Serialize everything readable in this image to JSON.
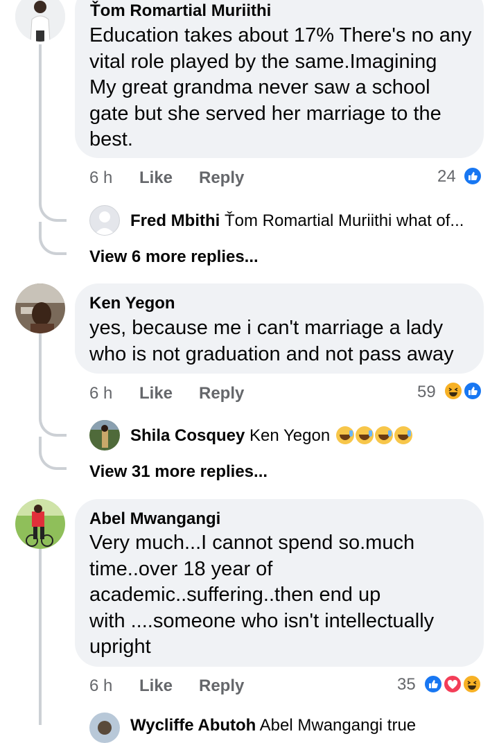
{
  "comments": [
    {
      "author": "Ťom Romartial Muriithi",
      "text": "Education takes about 17% There's no any\nvital role played by the same.Imagining\nMy great  grandma never saw a school\ngate but she served her marriage to the\nbest.",
      "time": "6 h",
      "like_label": "Like",
      "reply_label": "Reply",
      "reaction_count": "24",
      "reactions": [
        "like"
      ],
      "reply_preview": {
        "author": "Fred Mbithi",
        "text": "Ťom Romartial Muriithi what of..."
      },
      "view_more": "View 6 more replies..."
    },
    {
      "author": "Ken Yegon",
      "text": "yes, because me i can't marriage a lady\nwho is not graduation and not pass away",
      "time": "6 h",
      "like_label": "Like",
      "reply_label": "Reply",
      "reaction_count": "59",
      "reactions": [
        "haha",
        "like"
      ],
      "reply_preview": {
        "author": "Shila Cosquey",
        "text": "Ken Yegon"
      },
      "view_more": "View 31 more replies..."
    },
    {
      "author": "Abel Mwangangi",
      "text": "Very much...I cannot spend so.much\ntime..over 18 year of\nacademic..suffering..then end up\nwith ....someone who isn't intellectually\nupright",
      "time": "6 h",
      "like_label": "Like",
      "reply_label": "Reply",
      "reaction_count": "35",
      "reactions": [
        "like",
        "love",
        "haha"
      ],
      "reply_preview": {
        "author": "Wycliffe Abutoh",
        "text": "Abel Mwangangi true"
      }
    }
  ],
  "colors": {
    "like": "#1877f2",
    "love": "#f33e58",
    "haha": "#f7b125",
    "bubble": "#f0f2f5",
    "thread": "#ccd0d5"
  }
}
